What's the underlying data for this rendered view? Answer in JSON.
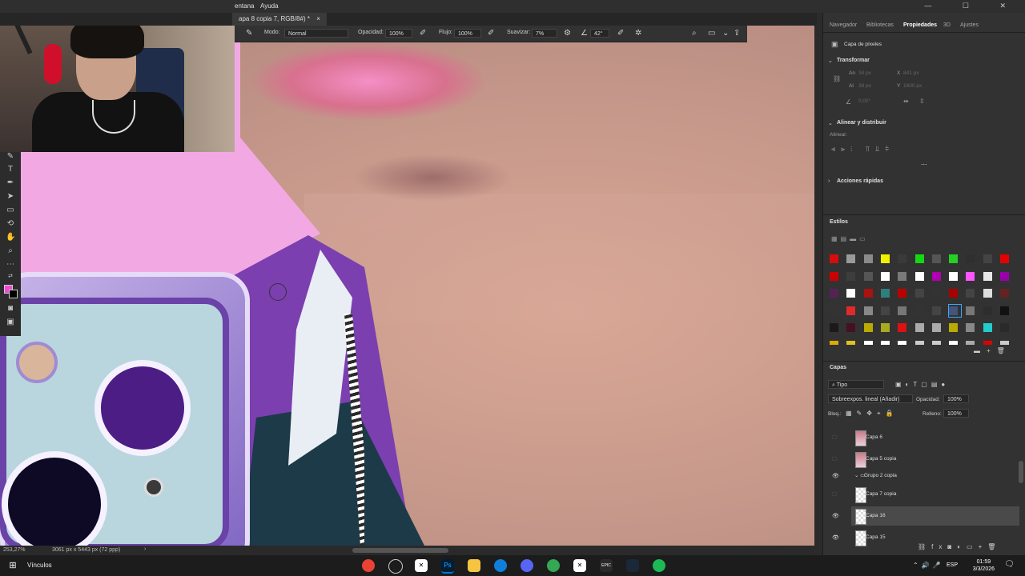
{
  "menubar": {
    "item1": "entana",
    "item2": "Ayuda",
    "controls": "—  ☐  ✕"
  },
  "document_tab": {
    "title": "apa 8 copia 7, RGB/8#) *",
    "close": "×"
  },
  "options": {
    "mode_label": "Modo:",
    "mode_value": "Normal",
    "opacity_label": "Opacidad:",
    "opacity_value": "100%",
    "flow_label": "Flujo:",
    "flow_value": "100%",
    "smooth_label": "Suavizar:",
    "smooth_value": "7%",
    "angle_value": "42°"
  },
  "status": {
    "zoom": "253,27%",
    "dimensions": "3061 px x 5443 px (72 ppp)"
  },
  "right_panel": {
    "tabs": [
      "Navegador",
      "Bibliotecas",
      "Propiedades",
      "3D",
      "Ajustes"
    ],
    "layer_kind": "Capa de píxeles",
    "transform_title": "Transformar",
    "an_label": "An",
    "an_value": "34 px",
    "x_label": "X",
    "x_value": "841 px",
    "al_label": "Al",
    "al_value": "38 px",
    "y_label": "Y",
    "y_value": "1600 px",
    "angle_value": "0,00°",
    "align_title": "Alinear y distribuir",
    "align_label": "Alinear:",
    "more": "...",
    "quick_title": "Acciones rápidas",
    "styles_title": "Estilos",
    "layers_title": "Capas",
    "filter_kind": "Tipo",
    "blend_mode": "Sobreexpos. lineal (Añadir)",
    "opacity_label": "Opacidad:",
    "opacity_value": "100%",
    "lock_label": "Bloq.:",
    "fill_label": "Relleno:",
    "fill_value": "100%",
    "layers": [
      "Capa 6",
      "Capa 5 copia",
      "Grupo 2 copia",
      "Capa 7 copia",
      "Capa 16",
      "Capa 15"
    ]
  },
  "taskbar": {
    "search_text": "Vínculos",
    "time": "01:59",
    "date": "3/3/2026",
    "lang": "ESP",
    "ps_label": "Ps",
    "epic_label": "EPIC"
  },
  "colors": {
    "foreground": "#f04bd6",
    "background": "#000000",
    "accent": "#0078d4"
  }
}
